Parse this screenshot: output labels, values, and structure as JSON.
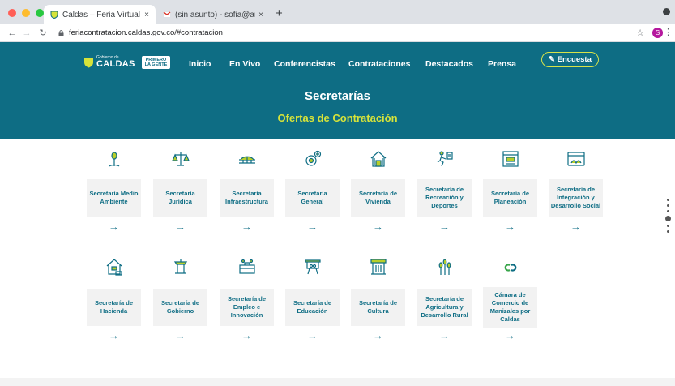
{
  "browser": {
    "tabs": [
      {
        "title": "Caldas – Feria Virtual de la Co",
        "active": true,
        "icon": "shield-favicon"
      },
      {
        "title": "(sin asunto) - sofia@amcoppic",
        "active": false,
        "icon": "gmail-icon"
      }
    ],
    "close_label": "×",
    "new_tab_label": "+",
    "url": "feriacontratacion.caldas.gov.co/#contratacion",
    "profile_initial": "S"
  },
  "header": {
    "logo_small": "Gobierno de",
    "logo_big": "CALDAS",
    "badge_line1": "PRIMERO",
    "badge_line2": "LA GENTE",
    "nav": [
      "Inicio",
      "En Vivo",
      "Conferencistas",
      "Contrataciones",
      "Destacados",
      "Prensa"
    ],
    "encuesta_label": "Encuesta",
    "title": "Secretarías",
    "subtitle": "Ofertas de Contratación"
  },
  "colors": {
    "primary": "#0e6d84",
    "accent": "#d6e33a",
    "card_bg": "#f2f2f2"
  },
  "row1": [
    {
      "label": "Secretaría Medio Ambiente",
      "icon": "plant-icon"
    },
    {
      "label": "Secretaría Jurídica",
      "icon": "scales-icon"
    },
    {
      "label": "Secretaría Infraestructura",
      "icon": "bridge-icon"
    },
    {
      "label": "Secretaría General",
      "icon": "gears-icon"
    },
    {
      "label": "Secretaría de Vivienda",
      "icon": "house-icon"
    },
    {
      "label": "Secretaría de Recreación y Deportes",
      "icon": "runner-icon"
    },
    {
      "label": "Secretaría de Planeación",
      "icon": "blueprint-icon"
    },
    {
      "label": "Secretaría de Integración y Desarrollo Social",
      "icon": "browser-window-icon"
    }
  ],
  "row2": [
    {
      "label": "Secretaría de Hacienda",
      "icon": "bank-house-icon"
    },
    {
      "label": "Secretaría de Gobierno",
      "icon": "podium-icon"
    },
    {
      "label": "Secretaría de Empleo e Innovación",
      "icon": "briefcase-people-icon"
    },
    {
      "label": "Secretaría de Educación",
      "icon": "chalkboard-icon"
    },
    {
      "label": "Secretaría de Cultura",
      "icon": "theater-icon"
    },
    {
      "label": "Secretaría de Agricultura y Desarrollo Rural",
      "icon": "wheat-icon"
    },
    {
      "label": "Cámara de Comercio de Manizales por Caldas",
      "icon": "chamber-logo-icon"
    }
  ],
  "arrow": "→"
}
